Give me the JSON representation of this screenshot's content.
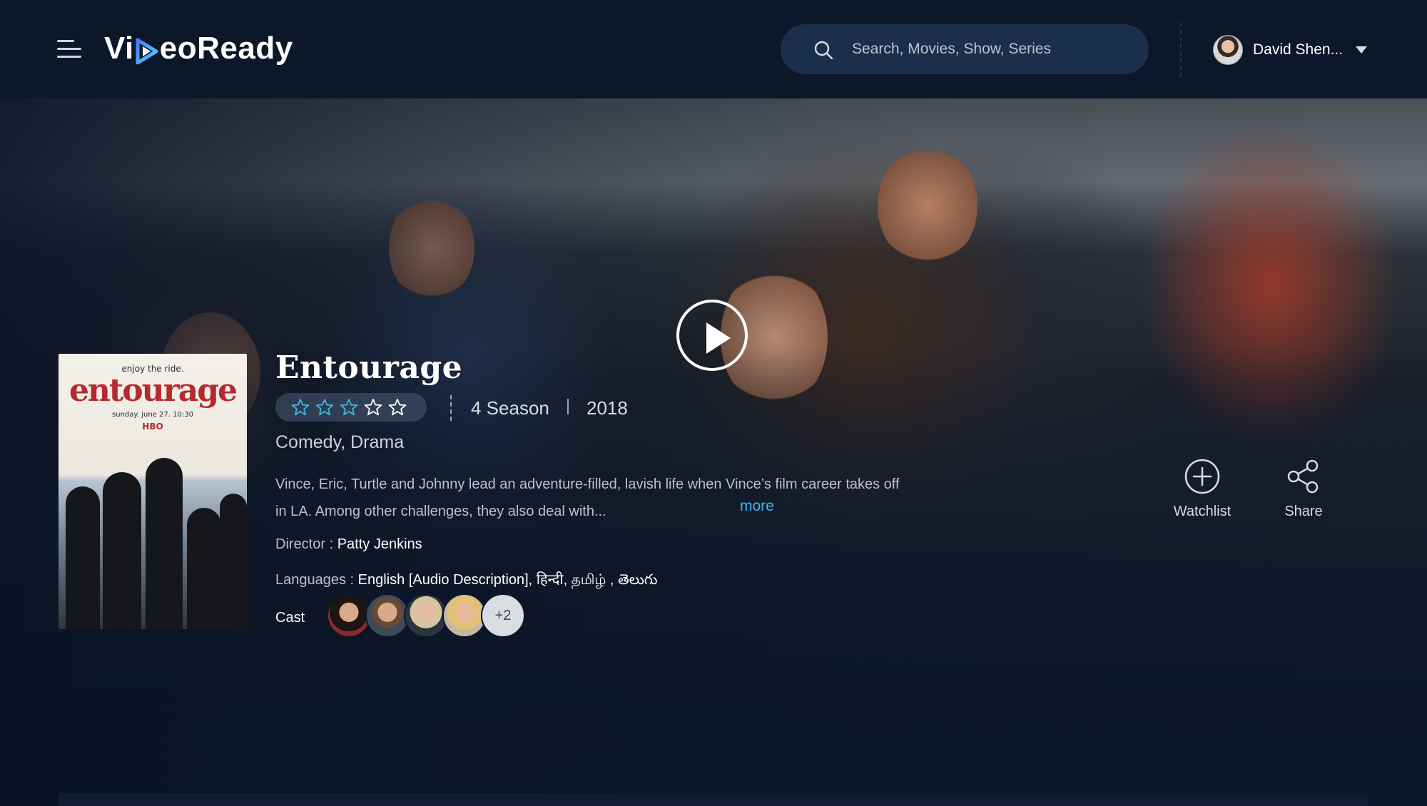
{
  "header": {
    "logo": {
      "prefix": "Vi",
      "suffix": "eoReady"
    },
    "search": {
      "placeholder": "Search, Movies, Show, Series",
      "value": ""
    },
    "user": {
      "name": "David Shen..."
    }
  },
  "show": {
    "title": "Entourage",
    "rating": {
      "value": 3,
      "max": 5
    },
    "seasons": "4 Season",
    "year": "2018",
    "genres": "Comedy, Drama",
    "description": "Vince, Eric, Turtle and Johnny lead an adventure-filled, lavish life when Vince’s film career takes off in LA. Among other challenges, they also deal with...",
    "more_label": "more",
    "director": {
      "label": "Director :",
      "value": "Patty Jenkins"
    },
    "languages": {
      "label": "Languages :",
      "value": "English [Audio Description],  हिन्दी,  தமிழ் , తెలుగు"
    },
    "cast": {
      "label": "Cast",
      "more_count": "+2"
    },
    "poster": {
      "tagline": "enjoy the ride.",
      "title": "entourage",
      "date": "sunday. june 27. 10:30",
      "network": "HBO"
    }
  },
  "actions": {
    "watchlist": "Watchlist",
    "share": "Share"
  },
  "colors": {
    "background": "#0b1628",
    "header": "#0c1729",
    "accent": "#3fb6ea",
    "search_bg": "#1b2f4c"
  },
  "icons": [
    "menu-icon",
    "play-logo-icon",
    "search-icon",
    "caret-down-icon",
    "play-icon",
    "star-icon",
    "plus-circle-icon",
    "share-icon"
  ]
}
